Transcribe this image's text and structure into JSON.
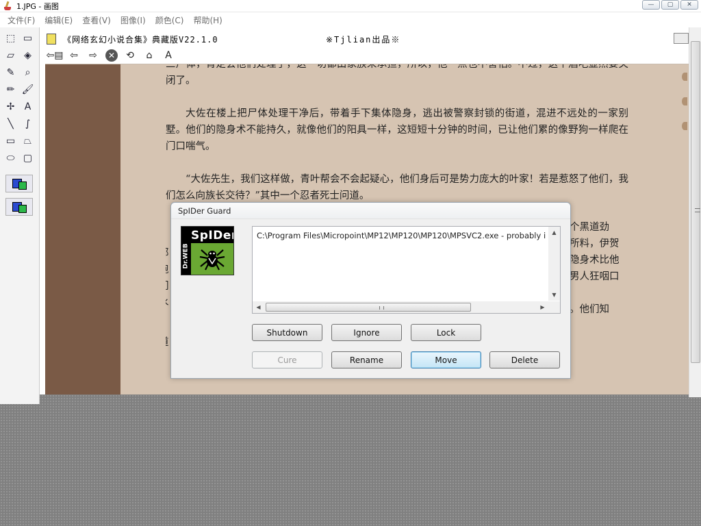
{
  "window": {
    "title": "1.JPG - 画图",
    "controls": [
      "—",
      "▢",
      "✕"
    ]
  },
  "menu": [
    "文件(F)",
    "编辑(E)",
    "查看(V)",
    "图像(I)",
    "颜色(C)",
    "帮助(H)"
  ],
  "tools": [
    {
      "name": "free-select",
      "glyph": "⬚"
    },
    {
      "name": "select",
      "glyph": "▭"
    },
    {
      "name": "eraser",
      "glyph": "▱"
    },
    {
      "name": "fill",
      "glyph": "◈"
    },
    {
      "name": "color-picker",
      "glyph": "✎"
    },
    {
      "name": "magnifier",
      "glyph": "⌕"
    },
    {
      "name": "pencil",
      "glyph": "✏"
    },
    {
      "name": "brush",
      "glyph": "🖌"
    },
    {
      "name": "airbrush",
      "glyph": "✢"
    },
    {
      "name": "text",
      "glyph": "A"
    },
    {
      "name": "line",
      "glyph": "╲"
    },
    {
      "name": "curve",
      "glyph": "∫"
    },
    {
      "name": "rectangle",
      "glyph": "▭"
    },
    {
      "name": "polygon",
      "glyph": "⏢"
    },
    {
      "name": "ellipse",
      "glyph": "⬭"
    },
    {
      "name": "rounded-rectangle",
      "glyph": "▢"
    }
  ],
  "viewer": {
    "title": "《网络玄幻小说合集》典藏版V22.1.0",
    "credit": "※Tjlian出品※",
    "toolbar": [
      "⇦▤",
      "⇦",
      "⇨",
      "✕",
      "⟲",
      "⌂",
      "A"
    ],
    "paragraphs": [
      "三户体，肯定会他们处理了，这一切都由家族来承担，所以，他一点也不害怕。不过，这个酒吧显然要关闭了。",
      "大佐在楼上把尸体处理干净后，带着手下集体隐身，逃出被警察封锁的街道，混进不远处的一家别墅。他们的隐身术不能持久，就像他们的阳具一样，这短短十分钟的时间，已让他们累的像野狗一样爬在门口喘气。",
      "“大佐先生，我们这样做，青叶帮会不会起疑心，他们身后可是势力庞大的叶家！若是惹怒了他们，我们怎么向族长交待？”其中一个忍者死士问道。"
    ],
    "right_fragments": [
      "个黑道劲",
      "所料，伊贺",
      "隐身术比他",
      "男人狂咽口",
      "。他们知"
    ],
    "left_fragments": [
      "部",
      "跑",
      "们",
      "水",
      "道"
    ],
    "bottom_fragment": "“步了。只抓而特别引说来，他是你大事不啥阿行中事情关人吃。"
  },
  "dialog": {
    "title": "SpIDer Guard",
    "logo_text": "SpIDer",
    "logo_brand": "Dr.WEB",
    "list_items": [
      "C:\\Program Files\\Micropoint\\MP12\\MP120\\MP120\\MPSVC2.exe - probably infected"
    ],
    "buttons_row1": [
      "Shutdown",
      "Ignore",
      "Lock"
    ],
    "buttons_row2": [
      "Cure",
      "Rename",
      "Move",
      "Delete"
    ],
    "disabled": [
      "Cure"
    ],
    "focused": "Move"
  }
}
